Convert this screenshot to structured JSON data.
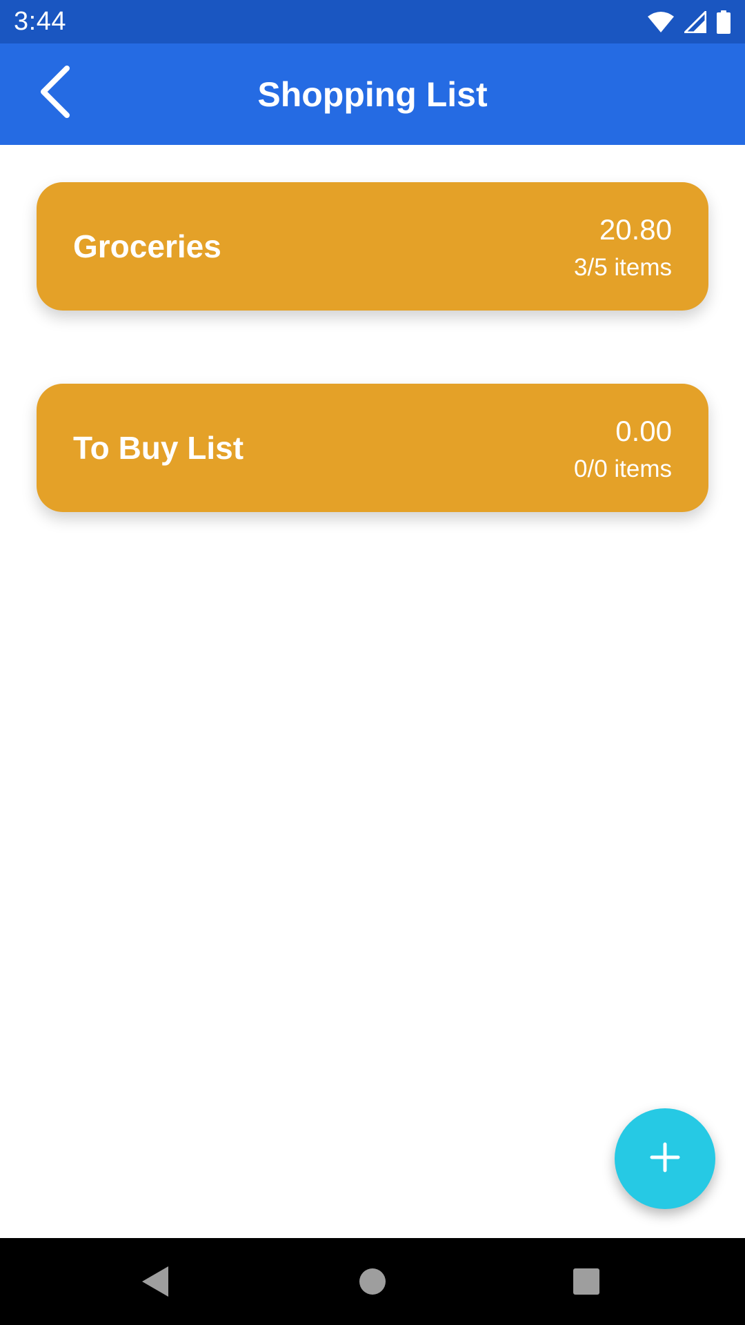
{
  "status_bar": {
    "time": "3:44",
    "icons": [
      "wifi-icon",
      "signal-icon",
      "battery-icon"
    ]
  },
  "app_bar": {
    "title": "Shopping List",
    "back_icon": "chevron-left-icon"
  },
  "lists": [
    {
      "name": "Groceries",
      "total": "20.80",
      "count": "3/5 items"
    },
    {
      "name": "To Buy List",
      "total": "0.00",
      "count": "0/0 items"
    }
  ],
  "fab": {
    "icon": "plus-icon"
  },
  "nav_bar": {
    "icons": [
      "nav-back-icon",
      "nav-home-icon",
      "nav-recents-icon"
    ]
  },
  "colors": {
    "status_bar": "#1a56c1",
    "app_bar": "#256be3",
    "card": "#e4a128",
    "fab": "#26c9e4",
    "nav_bar": "#000000"
  }
}
